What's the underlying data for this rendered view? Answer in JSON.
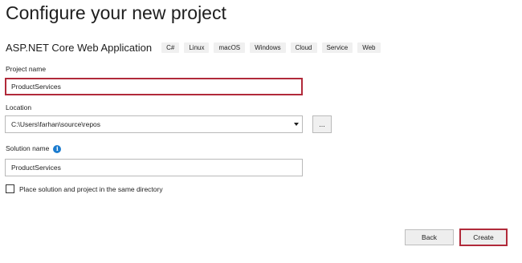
{
  "page": {
    "title": "Configure your new project"
  },
  "template": {
    "name": "ASP.NET Core Web Application",
    "tags": [
      "C#",
      "Linux",
      "macOS",
      "Windows",
      "Cloud",
      "Service",
      "Web"
    ]
  },
  "form": {
    "project_name_label": "Project name",
    "project_name_value": "ProductServices",
    "location_label": "Location",
    "location_value": "C:\\Users\\farhan\\source\\repos",
    "browse_label": "...",
    "solution_name_label": "Solution name",
    "solution_name_value": "ProductServices",
    "same_directory_label": "Place solution and project in the same directory",
    "same_directory_checked": false
  },
  "buttons": {
    "back_label": "Back",
    "create_label": "Create"
  },
  "colors": {
    "highlight": "#b12a3a",
    "info_icon": "#1c7ccf"
  },
  "icons": {
    "info": "info-icon",
    "dropdown": "chevron-down-icon"
  }
}
